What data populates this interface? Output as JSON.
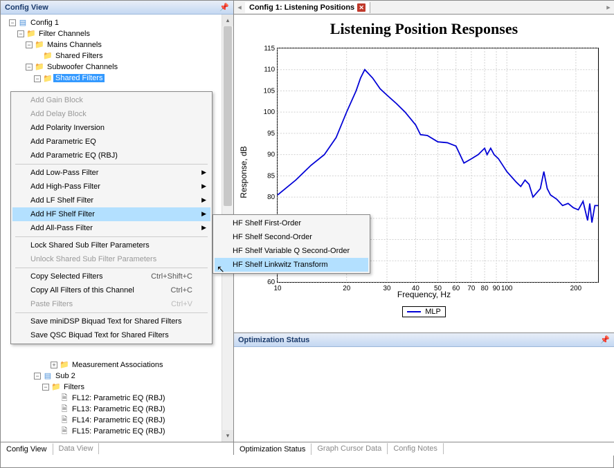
{
  "leftPanel": {
    "title": "Config View"
  },
  "tree": {
    "config": "Config 1",
    "filterChannels": "Filter Channels",
    "mainsChannels": "Mains Channels",
    "sharedFilters1": "Shared Filters",
    "subwooferChannels": "Subwoofer Channels",
    "sharedFilters2": "Shared Filters",
    "measAssoc": "Measurement Associations",
    "sub2": "Sub 2",
    "filters": "Filters",
    "fl12": "FL12: Parametric EQ (RBJ)",
    "fl13": "FL13: Parametric EQ (RBJ)",
    "fl14": "FL14: Parametric EQ (RBJ)",
    "fl15": "FL15: Parametric EQ (RBJ)"
  },
  "leftTabs": {
    "t1": "Config View",
    "t2": "Data View"
  },
  "chartTab": {
    "label": "Config 1: Listening Positions"
  },
  "optStatus": {
    "title": "Optimization Status"
  },
  "rightTabs": {
    "t1": "Optimization Status",
    "t2": "Graph Cursor Data",
    "t3": "Config Notes"
  },
  "contextMenu": {
    "addGain": "Add Gain Block",
    "addDelay": "Add Delay Block",
    "addPolarity": "Add Polarity Inversion",
    "addPEQ": "Add Parametric EQ",
    "addPEQRBJ": "Add Parametric EQ (RBJ)",
    "addLowPass": "Add Low-Pass Filter",
    "addHighPass": "Add High-Pass Filter",
    "addLFShelf": "Add LF Shelf Filter",
    "addHFShelf": "Add HF Shelf Filter",
    "addAllPass": "Add All-Pass Filter",
    "lockSharedSub": "Lock Shared Sub Filter Parameters",
    "unlockSharedSub": "Unlock Shared Sub Filter Parameters",
    "copySelected": "Copy Selected Filters",
    "copySelectedSC": "Ctrl+Shift+C",
    "copyAll": "Copy All Filters of this Channel",
    "copyAllSC": "Ctrl+C",
    "paste": "Paste Filters",
    "pasteSC": "Ctrl+V",
    "saveMiniDSP": "Save miniDSP Biquad Text for Shared Filters",
    "saveQSC": "Save QSC Biquad Text for Shared Filters"
  },
  "submenu": {
    "i1": "HF Shelf First-Order",
    "i2": "HF Shelf Second-Order",
    "i3": "HF Shelf Variable Q Second-Order",
    "i4": "HF Shelf Linkwitz Transform"
  },
  "chart_data": {
    "type": "line",
    "title": "Listening Position Responses",
    "xlabel": "Frequency, Hz",
    "ylabel": "Response, dB",
    "x_scale": "log",
    "xlim": [
      10,
      250
    ],
    "ylim": [
      60,
      115
    ],
    "yticks": [
      60,
      65,
      70,
      75,
      80,
      85,
      90,
      95,
      100,
      105,
      110,
      115
    ],
    "xticks": [
      10,
      20,
      30,
      40,
      50,
      60,
      70,
      80,
      90,
      100,
      200
    ],
    "series": [
      {
        "name": "MLP",
        "x": [
          10,
          12,
          14,
          16,
          18,
          20,
          22,
          23,
          24,
          26,
          28,
          30,
          33,
          36,
          40,
          42,
          45,
          50,
          55,
          60,
          65,
          70,
          75,
          80,
          82,
          85,
          88,
          92,
          100,
          110,
          115,
          120,
          125,
          130,
          140,
          145,
          150,
          155,
          165,
          175,
          185,
          195,
          205,
          215,
          225,
          230,
          235,
          242,
          250
        ],
        "y": [
          80.5,
          84,
          87.5,
          90,
          94,
          100,
          105,
          108,
          110,
          108,
          105.5,
          104,
          102,
          100,
          97,
          94.7,
          94.5,
          93,
          92.8,
          92,
          88,
          89,
          90,
          91.5,
          90,
          91.5,
          90,
          89,
          86,
          83.5,
          82.5,
          84,
          83,
          80,
          82,
          86,
          82,
          80.5,
          79.5,
          78,
          78.5,
          77.5,
          77,
          79,
          74.5,
          78.5,
          74,
          78,
          78
        ]
      }
    ],
    "legend": [
      "MLP"
    ]
  }
}
